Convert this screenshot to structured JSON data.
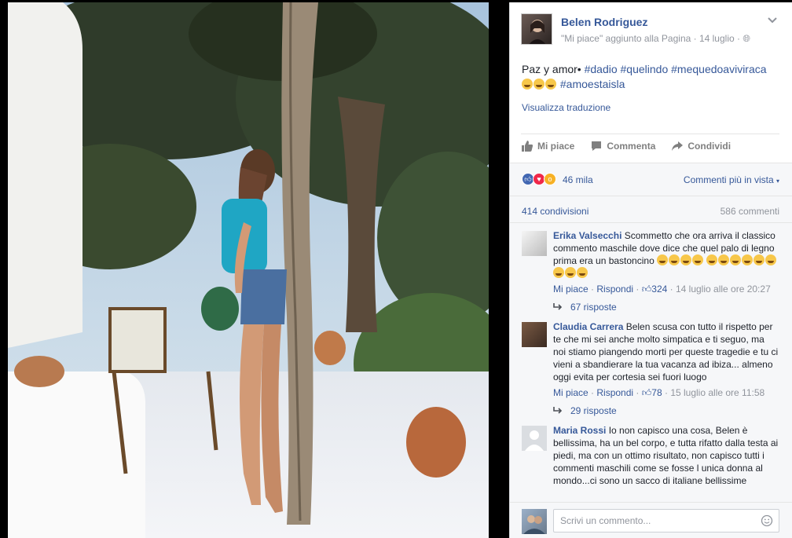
{
  "post": {
    "author": "Belen Rodriguez",
    "meta": "\"Mi piace\" aggiunto alla Pagina · 14 luglio · ",
    "text_prefix": "Paz y amor• ",
    "tags_line1": "#dadio #quelindo #mequedoaviviraca",
    "tags_line2": "#amoestaisla",
    "translate": "Visualizza traduzione"
  },
  "actions": {
    "like": "Mi piace",
    "comment": "Commenta",
    "share": "Condividi"
  },
  "reactions": {
    "count": "46 mila",
    "sort": "Commenti più in vista"
  },
  "stats": {
    "shares": "414 condivisioni",
    "comments": "586 commenti"
  },
  "comments": [
    {
      "author": "Erika Valsecchi",
      "body": " Scommetto che ora arriva il classico commento maschile dove dice che quel palo di legno prima era un bastoncino",
      "like": "Mi piace",
      "reply": "Rispondi",
      "likes": "324",
      "time": "14 luglio alle ore 20:27",
      "replies": "67 risposte"
    },
    {
      "author": "Claudia Carrera",
      "body": " Belen scusa con tutto il rispetto per te che mi sei anche molto simpatica e ti seguo, ma noi stiamo piangendo morti per queste tragedie e tu ci vieni a sbandierare la tua vacanza ad ibiza... almeno oggi evita per cortesia sei fuori luogo",
      "like": "Mi piace",
      "reply": "Rispondi",
      "likes": "78",
      "time": "15 luglio alle ore 11:58",
      "replies": "29 risposte"
    },
    {
      "author": "Maria Rossi",
      "body": " Io non capisco una cosa, Belen è bellissima, ha un bel corpo, e tutta rifatto dalla testa ai piedi, ma con un ottimo risultato, non capisco tutti i commenti maschili come se fosse l unica donna al mondo...ci sono un sacco di italiane bellissime"
    }
  ],
  "composer": {
    "placeholder": "Scrivi un commento..."
  }
}
